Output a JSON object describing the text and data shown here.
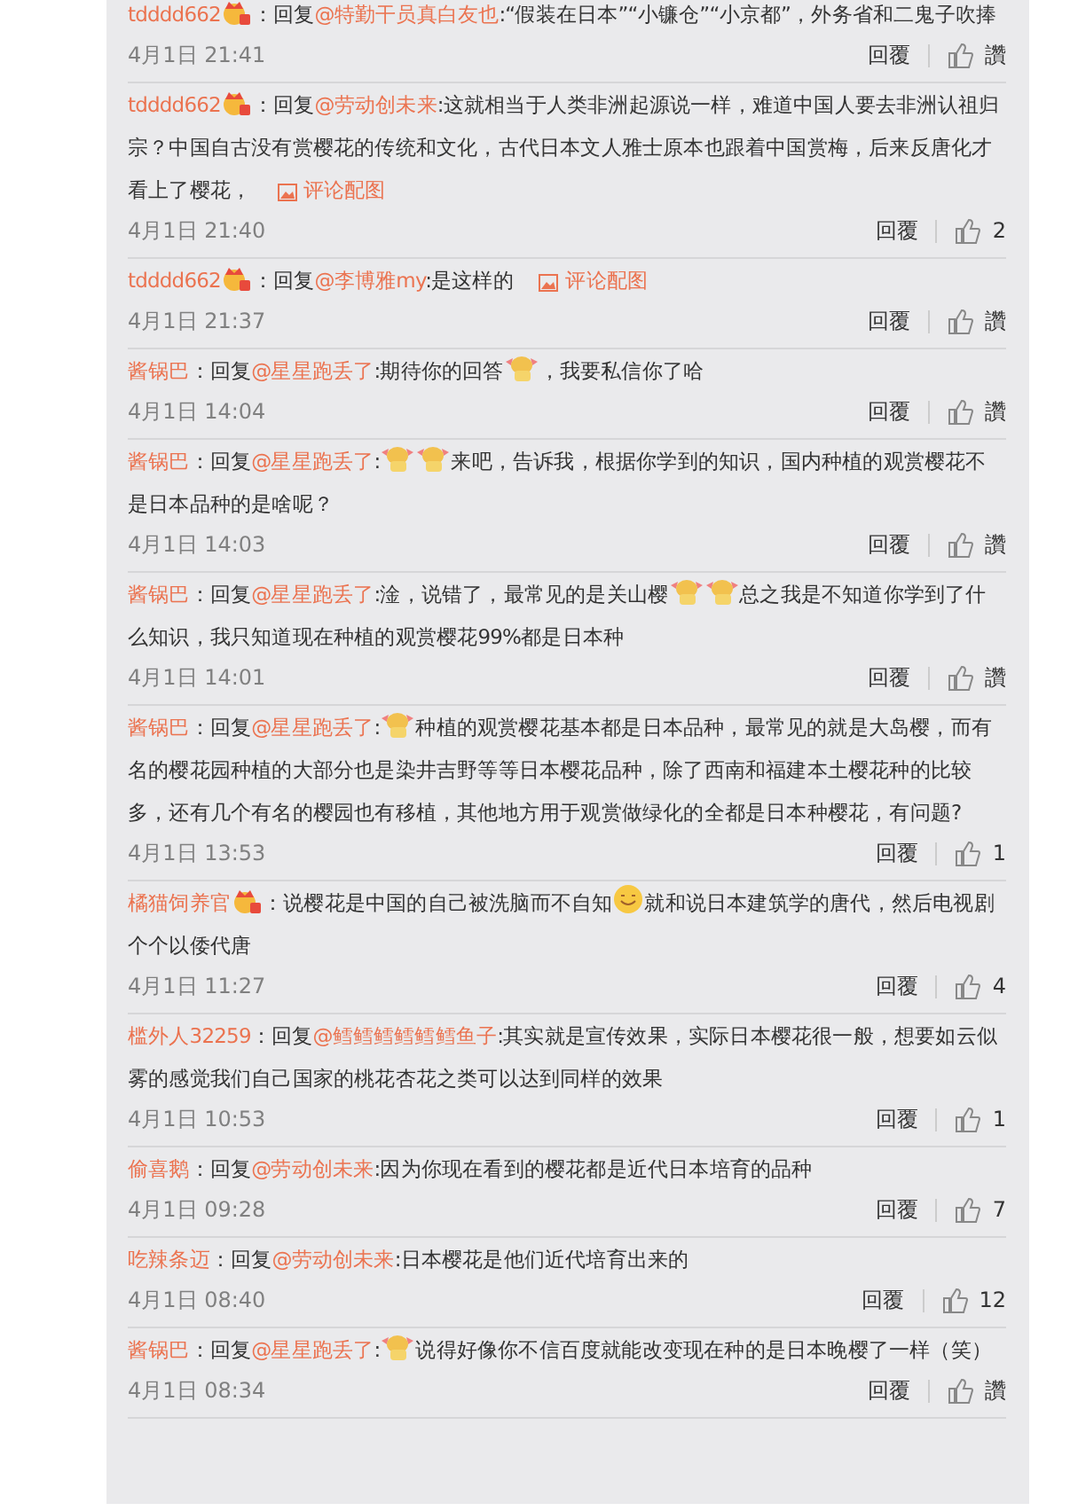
{
  "comments": [
    {
      "segments": [
        {
          "kind": "user",
          "text": "tdddd662"
        },
        {
          "kind": "badge"
        },
        {
          "kind": "text",
          "text": "：回复"
        },
        {
          "kind": "mention",
          "text": "@特勤干员真白友也"
        },
        {
          "kind": "text",
          "text": ":“假装在日本”“小镰仓”“小京都”，外务省和二鬼子吹捧"
        }
      ],
      "time": "4月1日 21:41",
      "reply": "回覆",
      "likes": "讚"
    },
    {
      "segments": [
        {
          "kind": "user",
          "text": "tdddd662"
        },
        {
          "kind": "badge"
        },
        {
          "kind": "text",
          "text": "：回复"
        },
        {
          "kind": "mention",
          "text": "@劳动创未来"
        },
        {
          "kind": "text",
          "text": ":这就相当于人类非洲起源说一样，难道中国人要去非洲认祖归宗？中国自古没有赏樱花的传统和文化，古代日本文人雅士原本也跟着中国赏梅，后来反唐化才看上了樱花，"
        },
        {
          "kind": "link",
          "text": "评论配图"
        }
      ],
      "time": "4月1日 21:40",
      "reply": "回覆",
      "likes": "2"
    },
    {
      "segments": [
        {
          "kind": "user",
          "text": "tdddd662"
        },
        {
          "kind": "badge"
        },
        {
          "kind": "text",
          "text": "：回复"
        },
        {
          "kind": "mention",
          "text": "@李博雅my"
        },
        {
          "kind": "text",
          "text": ":是这样的"
        },
        {
          "kind": "link",
          "text": "评论配图"
        }
      ],
      "time": "4月1日 21:37",
      "reply": "回覆",
      "likes": "讚"
    },
    {
      "segments": [
        {
          "kind": "user",
          "text": "酱锅巴"
        },
        {
          "kind": "text",
          "text": "：回复"
        },
        {
          "kind": "mention",
          "text": "@星星跑丢了"
        },
        {
          "kind": "text",
          "text": ":期待你的回答"
        },
        {
          "kind": "sticker"
        },
        {
          "kind": "text",
          "text": "，我要私信你了哈"
        }
      ],
      "time": "4月1日 14:04",
      "reply": "回覆",
      "likes": "讚"
    },
    {
      "segments": [
        {
          "kind": "user",
          "text": "酱锅巴"
        },
        {
          "kind": "text",
          "text": "：回复"
        },
        {
          "kind": "mention",
          "text": "@星星跑丢了"
        },
        {
          "kind": "text",
          "text": ":"
        },
        {
          "kind": "sticker"
        },
        {
          "kind": "sticker"
        },
        {
          "kind": "text",
          "text": "来吧，告诉我，根据你学到的知识，国内种植的观赏樱花不是日本品种的是啥呢？"
        }
      ],
      "time": "4月1日 14:03",
      "reply": "回覆",
      "likes": "讚"
    },
    {
      "segments": [
        {
          "kind": "user",
          "text": "酱锅巴"
        },
        {
          "kind": "text",
          "text": "：回复"
        },
        {
          "kind": "mention",
          "text": "@星星跑丢了"
        },
        {
          "kind": "text",
          "text": ":淦，说错了，最常见的是关山樱"
        },
        {
          "kind": "sticker"
        },
        {
          "kind": "sticker"
        },
        {
          "kind": "text",
          "text": "总之我是不知道你学到了什么知识，我只知道现在种植的观赏樱花99%都是日本种"
        }
      ],
      "time": "4月1日 14:01",
      "reply": "回覆",
      "likes": "讚"
    },
    {
      "segments": [
        {
          "kind": "user",
          "text": "酱锅巴"
        },
        {
          "kind": "text",
          "text": "：回复"
        },
        {
          "kind": "mention",
          "text": "@星星跑丢了"
        },
        {
          "kind": "text",
          "text": ":"
        },
        {
          "kind": "sticker"
        },
        {
          "kind": "text",
          "text": "种植的观赏樱花基本都是日本品种，最常见的就是大岛樱，而有名的樱花园种植的大部分也是染井吉野等等日本樱花品种，除了西南和福建本土樱花种的比较多，还有几个有名的樱园也有移植，其他地方用于观赏做绿化的全都是日本种樱花，有问题?"
        }
      ],
      "time": "4月1日 13:53",
      "reply": "回覆",
      "likes": "1"
    },
    {
      "segments": [
        {
          "kind": "user",
          "text": "橘猫饲养官"
        },
        {
          "kind": "badge"
        },
        {
          "kind": "text",
          "text": "：说樱花是中国的自己被洗脑而不自知"
        },
        {
          "kind": "smiley"
        },
        {
          "kind": "text",
          "text": "就和说日本建筑学的唐代，然后电视剧个个以倭代唐"
        }
      ],
      "time": "4月1日 11:27",
      "reply": "回覆",
      "likes": "4"
    },
    {
      "segments": [
        {
          "kind": "user",
          "text": "槛外人32259"
        },
        {
          "kind": "text",
          "text": "：回复"
        },
        {
          "kind": "mention",
          "text": "@鳕鳕鳕鳕鳕鳕鱼子"
        },
        {
          "kind": "text",
          "text": ":其实就是宣传效果，实际日本樱花很一般，想要如云似雾的感觉我们自己国家的桃花杏花之类可以达到同样的效果"
        }
      ],
      "time": "4月1日 10:53",
      "reply": "回覆",
      "likes": "1"
    },
    {
      "segments": [
        {
          "kind": "user",
          "text": "偷喜鹅"
        },
        {
          "kind": "text",
          "text": "：回复"
        },
        {
          "kind": "mention",
          "text": "@劳动创未来"
        },
        {
          "kind": "text",
          "text": ":因为你现在看到的樱花都是近代日本培育的品种"
        }
      ],
      "time": "4月1日 09:28",
      "reply": "回覆",
      "likes": "7"
    },
    {
      "segments": [
        {
          "kind": "user",
          "text": "吃辣条迈"
        },
        {
          "kind": "text",
          "text": "：回复"
        },
        {
          "kind": "mention",
          "text": "@劳动创未来"
        },
        {
          "kind": "text",
          "text": ":日本樱花是他们近代培育出来的"
        }
      ],
      "time": "4月1日 08:40",
      "reply": "回覆",
      "likes": "12"
    },
    {
      "segments": [
        {
          "kind": "user",
          "text": "酱锅巴"
        },
        {
          "kind": "text",
          "text": "：回复"
        },
        {
          "kind": "mention",
          "text": "@星星跑丢了"
        },
        {
          "kind": "text",
          "text": ":"
        },
        {
          "kind": "sticker"
        },
        {
          "kind": "text",
          "text": "说得好像你不信百度就能改变现在种的是日本晚樱了一样（笑）"
        }
      ],
      "time": "4月1日 08:34",
      "reply": "回覆",
      "likes": "讚"
    }
  ]
}
